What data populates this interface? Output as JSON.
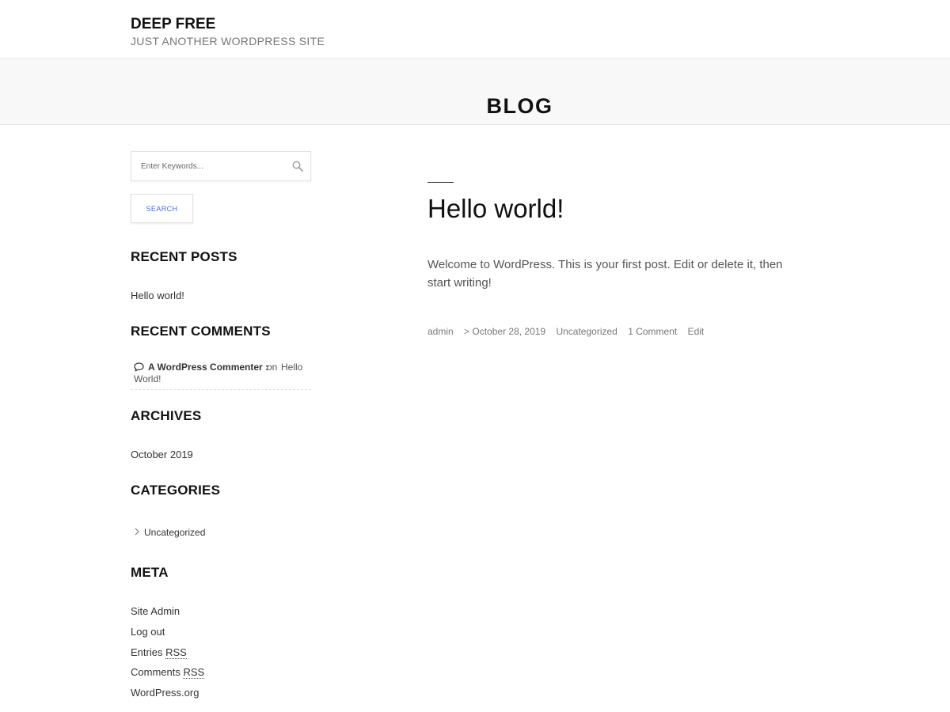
{
  "header": {
    "site_title": "DEEP FREE",
    "tagline": "JUST ANOTHER WORDPRESS SITE"
  },
  "banner": {
    "title": "BLOG"
  },
  "sidebar": {
    "search": {
      "placeholder": "Enter Keywords...",
      "button_label": "SEARCH",
      "icon": "search-icon"
    },
    "recent_posts": {
      "title": "RECENT POSTS",
      "items": [
        "Hello world!"
      ]
    },
    "recent_comments": {
      "title": "RECENT COMMENTS",
      "items": [
        {
          "author": "A WordPress Commenter :",
          "on_text": "on",
          "post_part1": "Hello",
          "post_part2": "World!",
          "icon": "comment-icon"
        }
      ]
    },
    "archives": {
      "title": "ARCHIVES",
      "items": [
        "October 2019"
      ]
    },
    "categories": {
      "title": "CATEGORIES",
      "items": [
        "Uncategorized"
      ],
      "icon": "chevron-right-icon"
    },
    "meta": {
      "title": "META",
      "items": [
        "Site Admin",
        "Log out",
        "Entries",
        "Comments",
        "WordPress.org"
      ],
      "rss_abbr": "RSS"
    }
  },
  "post": {
    "title": "Hello world!",
    "excerpt": "Welcome to WordPress. This is your first post. Edit or delete it, then start writing!",
    "meta": {
      "author": "admin",
      "date": "> October 28, 2019",
      "category": "Uncategorized",
      "comments": "1 Comment",
      "edit": "Edit"
    }
  },
  "colors": {
    "accent": "#4a6fd8",
    "banner_bg": "#f8f8f8",
    "text_dark": "#111111",
    "text_muted": "#777777"
  }
}
